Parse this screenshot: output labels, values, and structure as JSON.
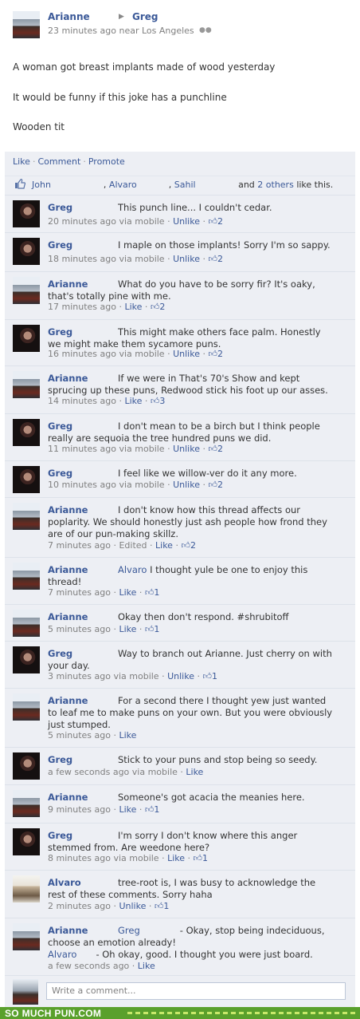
{
  "post": {
    "author": "Arianne",
    "arrow": "▶",
    "recipient": "Greg",
    "meta": "23 minutes ago near Los Angeles",
    "lines": [
      "A woman got breast implants made of wood yesterday",
      "It would be funny if this joke has a punchline",
      "Wooden tit"
    ]
  },
  "actions": {
    "like": "Like",
    "comment": "Comment",
    "promote": "Promote"
  },
  "likes": {
    "name1": "John",
    "name2": "Alvaro",
    "name3": "Sahil",
    "and": "and",
    "others": "2 others",
    "suffix": "like this."
  },
  "comments": [
    {
      "name": "Greg",
      "text": "This punch line... I couldn't cedar.",
      "meta": "20 minutes ago via mobile · ",
      "action": "Unlike",
      "count": "2"
    },
    {
      "name": "Greg",
      "text": "I maple on those implants! Sorry I'm so sappy.",
      "meta": "18 minutes ago via mobile · ",
      "action": "Unlike",
      "count": "2"
    },
    {
      "name": "Arianne",
      "text": "What do you have to be sorry fir? It's oaky, that's totally pine with me.",
      "meta": "17 minutes ago · ",
      "action": "Like",
      "count": "2"
    },
    {
      "name": "Greg",
      "text": "This might make others face palm. Honestly we might make them sycamore puns.",
      "meta": "16 minutes ago via mobile · ",
      "action": "Unlike",
      "count": "2"
    },
    {
      "name": "Arianne",
      "text": "If we were in That's 70's Show and kept sprucing up these puns, Redwood stick his foot up our asses.",
      "meta": "14 minutes ago · ",
      "action": "Like",
      "count": "3"
    },
    {
      "name": "Greg",
      "text": "I don't mean to be a birch but I think people really are sequoia the tree hundred puns we did.",
      "meta": "11 minutes ago via mobile · ",
      "action": "Unlike",
      "count": "2"
    },
    {
      "name": "Greg",
      "text": "I feel like we willow-ver do it any more.",
      "meta": "10 minutes ago via mobile · ",
      "action": "Unlike",
      "count": "2"
    },
    {
      "name": "Arianne",
      "text": "I don't know how this thread affects our poplarity. We should honestly just ash people how frond they are of our pun-making skillz.",
      "meta": "7 minutes ago · Edited · ",
      "action": "Like",
      "count": "2"
    },
    {
      "name": "Arianne",
      "mention": "Alvaro",
      "text": "I thought yule be one to enjoy this thread!",
      "meta": "7 minutes ago · ",
      "action": "Like",
      "count": "1"
    },
    {
      "name": "Arianne",
      "text": "Okay then don't respond. #shrubitoff",
      "meta": "5 minutes ago · ",
      "action": "Like",
      "count": "1"
    },
    {
      "name": "Greg",
      "text": "Way to branch out Arianne. Just cherry on with your day.",
      "meta": "3 minutes ago via mobile · ",
      "action": "Unlike",
      "count": "1"
    },
    {
      "name": "Arianne",
      "text": "For a second there I thought yew just wanted to leaf me to make puns on your own. But you were obviously just stumped.",
      "meta": "5 minutes ago · ",
      "action": "Like",
      "count": ""
    },
    {
      "name": "Greg",
      "text": "Stick to your puns and stop being so seedy.",
      "meta": "a few seconds ago via mobile · ",
      "action": "Like",
      "count": ""
    },
    {
      "name": "Arianne",
      "text": "Someone's got acacia the meanies here.",
      "meta": "9 minutes ago · ",
      "action": "Like",
      "count": "1"
    },
    {
      "name": "Greg",
      "text": "I'm sorry I don't know where this anger stemmed from. Are weedone here?",
      "meta": "8 minutes ago via mobile · ",
      "action": "Like",
      "count": "1"
    },
    {
      "name": "Alvaro",
      "text": "tree-root is, I was busy to acknowledge the rest of these comments. Sorry haha",
      "meta": "2 minutes ago · ",
      "action": "Unlike",
      "count": "1"
    }
  ],
  "last_comment": {
    "name": "Arianne",
    "mention1": "Greg",
    "text1": "- Okay, stop being indeciduous, choose an emotion already!",
    "mention2": "Alvaro",
    "text2": "- Oh okay, good. I thought you were just board.",
    "meta": "a few seconds ago · ",
    "action": "Like"
  },
  "write": {
    "placeholder": "Write a comment..."
  },
  "footer": {
    "text": "SO MUCH PUN.COM"
  }
}
